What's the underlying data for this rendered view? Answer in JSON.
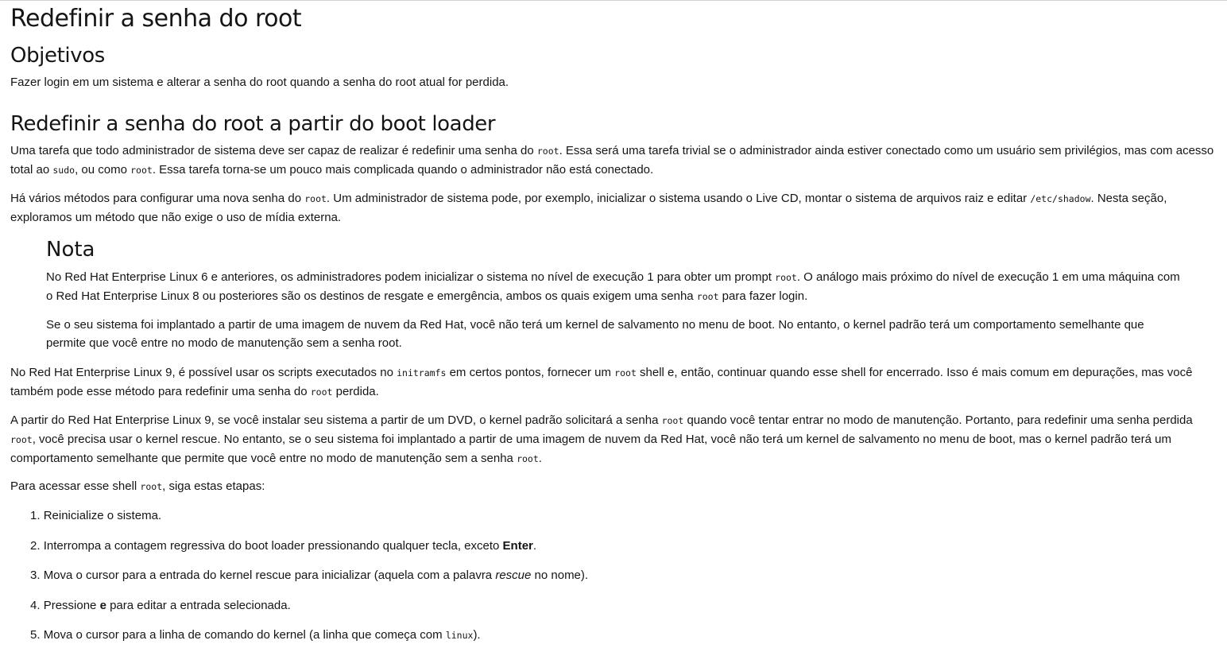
{
  "page": {
    "title": "Redefinir a senha do root",
    "objectives": {
      "heading": "Objetivos",
      "text": "Fazer login em um sistema e alterar a senha do root quando a senha do root atual for perdida."
    },
    "section": {
      "heading": "Redefinir a senha do root a partir do boot loader",
      "p1": {
        "a": "Uma tarefa que todo administrador de sistema deve ser capaz de realizar é redefinir uma senha do ",
        "code1": "root",
        "b": ". Essa será uma tarefa trivial se o administrador ainda estiver conectado como um usuário sem privilégios, mas com acesso total ao ",
        "code2": "sudo",
        "c": ", ou como ",
        "code3": "root",
        "d": ". Essa tarefa torna-se um pouco mais complicada quando o administrador não está conectado."
      },
      "p2": {
        "a": "Há vários métodos para configurar uma nova senha do ",
        "code1": "root",
        "b": ". Um administrador de sistema pode, por exemplo, inicializar o sistema usando o Live CD, montar o sistema de arquivos raiz e editar ",
        "code2": "/etc/shadow",
        "c": ". Nesta seção, exploramos um método que não exige o uso de mídia externa."
      },
      "note": {
        "title": "Nota",
        "p1": {
          "a": "No Red Hat Enterprise Linux 6 e anteriores, os administradores podem inicializar o sistema no nível de execução 1 para obter um prompt ",
          "code1": "root",
          "b": ". O análogo mais próximo do nível de execução 1 em uma máquina com o Red Hat Enterprise Linux 8 ou posteriores são os destinos de resgate e emergência, ambos os quais exigem uma senha ",
          "code2": "root",
          "c": " para fazer login."
        },
        "p2": "Se o seu sistema foi implantado a partir de uma imagem de nuvem da Red Hat, você não terá um kernel de salvamento no menu de boot. No entanto, o kernel padrão terá um comportamento semelhante que permite que você entre no modo de manutenção sem a senha root."
      },
      "p3": {
        "a": "No Red Hat Enterprise Linux 9, é possível usar os scripts executados no ",
        "code1": "initramfs",
        "b": " em certos pontos, fornecer um ",
        "code2": "root",
        "c": " shell e, então, continuar quando esse shell for encerrado. Isso é mais comum em depurações, mas você também pode esse método para redefinir uma senha do ",
        "code3": "root",
        "d": " perdida."
      },
      "p4": {
        "a": "A partir do Red Hat Enterprise Linux 9, se você instalar seu sistema a partir de um DVD, o kernel padrão solicitará a senha ",
        "code1": "root",
        "b": " quando você tentar entrar no modo de manutenção. Portanto, para redefinir uma senha perdida ",
        "code2": "root",
        "c": ", você precisa usar o kernel rescue. No entanto, se o seu sistema foi implantado a partir de uma imagem de nuvem da Red Hat, você não terá um kernel de salvamento no menu de boot, mas o kernel padrão terá um comportamento semelhante que permite que você entre no modo de manutenção sem a senha ",
        "code3": "root",
        "d": "."
      },
      "p5": {
        "a": "Para acessar esse shell ",
        "code1": "root",
        "b": ", siga estas etapas:"
      },
      "steps": [
        {
          "num": "1.",
          "a": "Reinicialize o sistema."
        },
        {
          "num": "2.",
          "a": "Interrompa a contagem regressiva do boot loader pressionando qualquer tecla, exceto ",
          "bold": "Enter",
          "b": "."
        },
        {
          "num": "3.",
          "a": "Mova o cursor para a entrada do kernel rescue para inicializar (aquela com a palavra ",
          "italic": "rescue",
          "b": " no nome)."
        },
        {
          "num": "4.",
          "a": "Pressione ",
          "bold": "e",
          "b": " para editar a entrada selecionada."
        },
        {
          "num": "5.",
          "a": "Mova o cursor para a linha de comando do kernel (a linha que começa com ",
          "code": "linux",
          "b": ")."
        }
      ]
    }
  }
}
